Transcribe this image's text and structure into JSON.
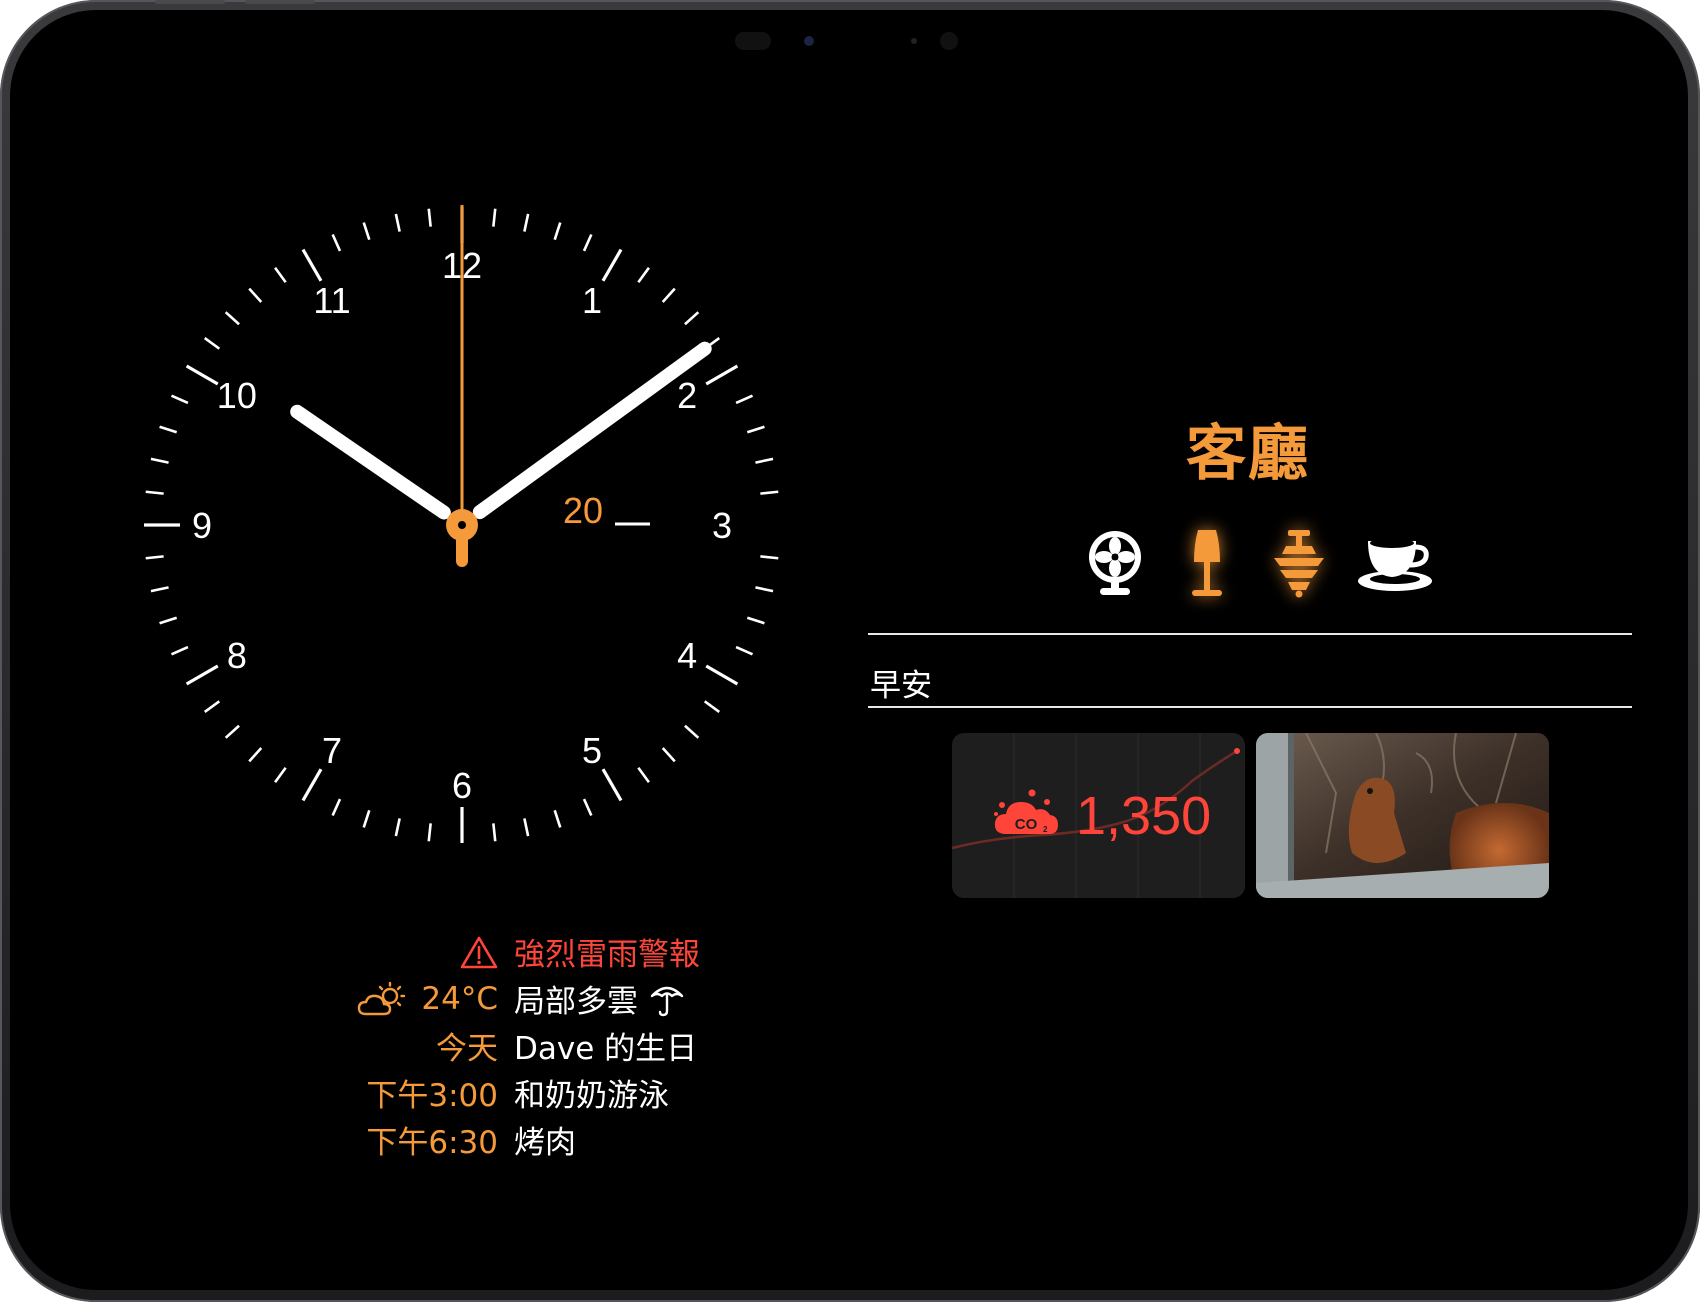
{
  "clock": {
    "numerals": [
      "12",
      "1",
      "2",
      "3",
      "4",
      "5",
      "6",
      "7",
      "8",
      "9",
      "10",
      "11"
    ],
    "date": "20",
    "time": {
      "hour": 10,
      "minute": 9,
      "second": 0
    },
    "hand_color": "#ffffff",
    "second_hand_color": "#f59a3a"
  },
  "agenda": {
    "alert": {
      "icon": "warning-triangle-icon",
      "text": "強烈雷雨警報",
      "color": "#ff453a"
    },
    "weather": {
      "icon": "partly-sunny-icon",
      "temperature": "24°C",
      "condition": "局部多雲",
      "extra_icon": "umbrella-icon"
    },
    "events": [
      {
        "when": "今天",
        "title": "Dave 的生日"
      },
      {
        "when": "下午3:00",
        "title": "和奶奶游泳"
      },
      {
        "when": "下午6:30",
        "title": "烤肉"
      }
    ]
  },
  "home": {
    "room": "客廳",
    "accent_color": "#f59a3a",
    "devices": [
      {
        "name": "fan-icon",
        "state": "off"
      },
      {
        "name": "floor-lamp-icon",
        "state": "on"
      },
      {
        "name": "ceiling-light-icon",
        "state": "on"
      },
      {
        "name": "coffee-cup-icon",
        "state": "off"
      }
    ],
    "scene": "早安",
    "co2": {
      "icon": "co2-cloud-icon",
      "value": "1,350",
      "color": "#ff453a"
    },
    "camera": {
      "description": ""
    }
  }
}
